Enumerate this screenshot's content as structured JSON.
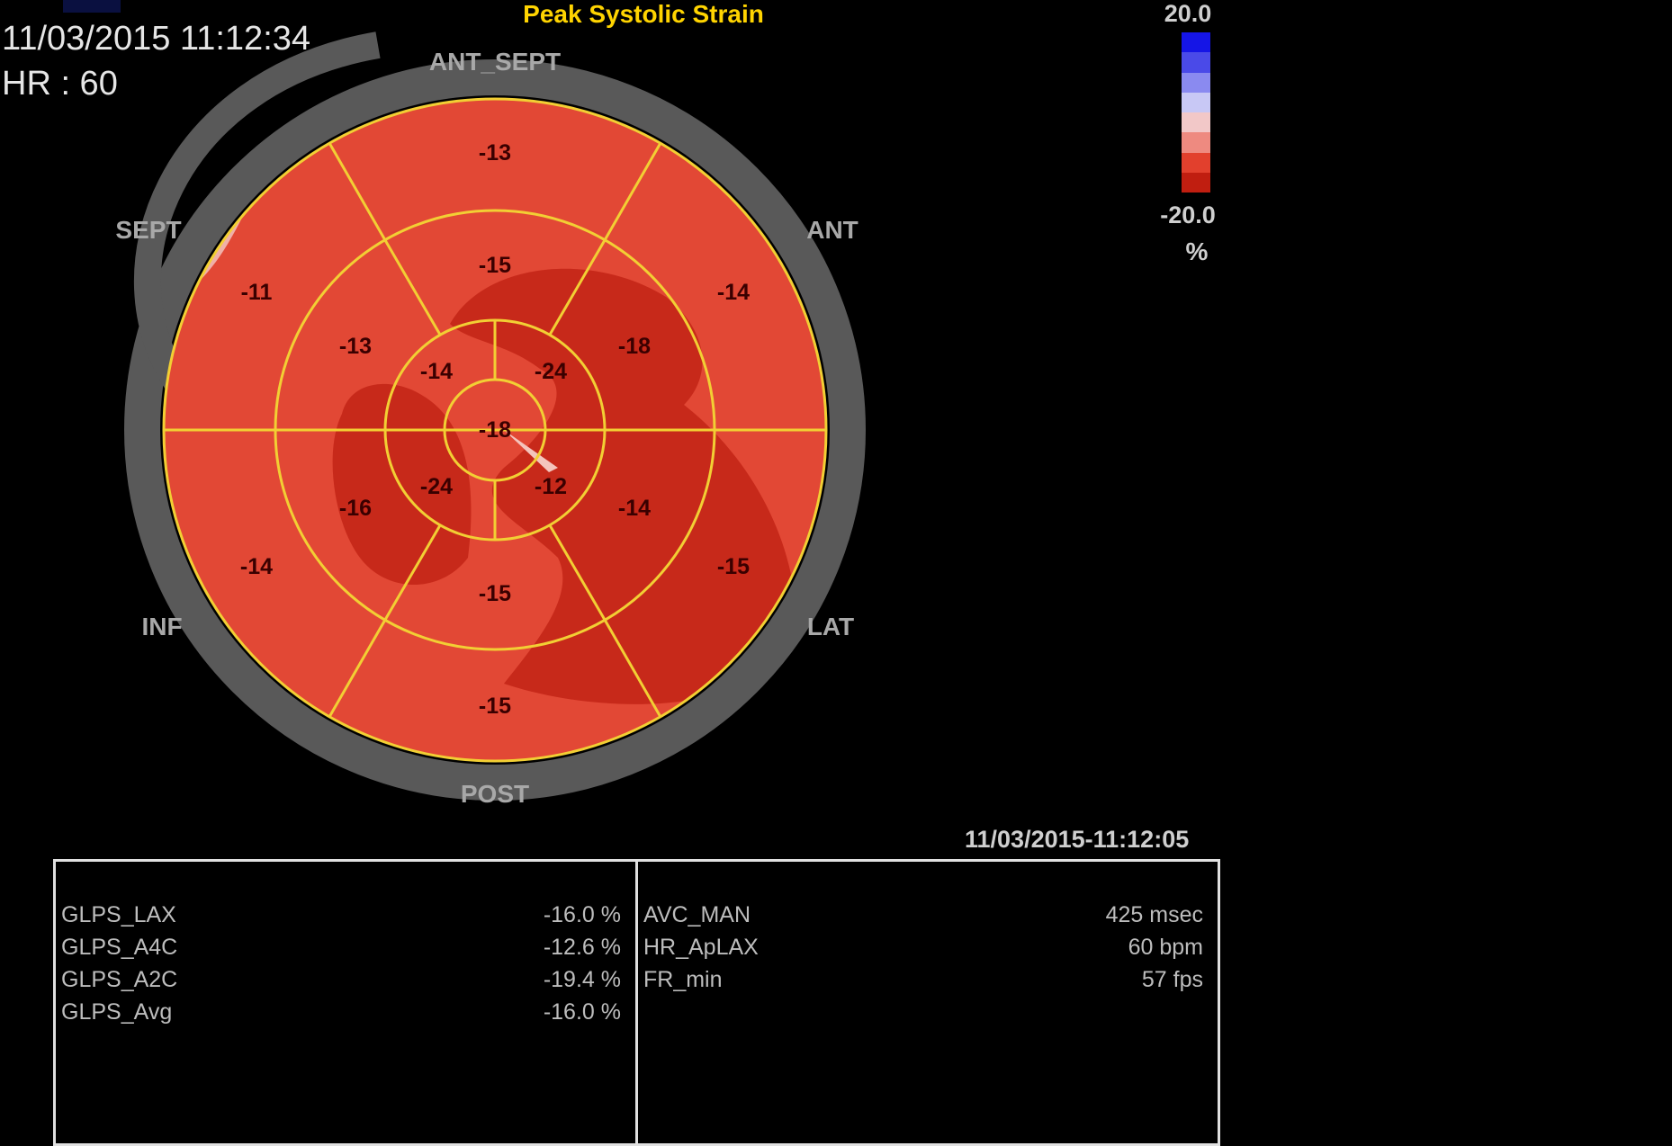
{
  "header": {
    "timestamp": "11/03/2015 11:12:34",
    "hr": "HR : 60",
    "title": "Peak Systolic Strain"
  },
  "scale": {
    "max_label": "20.0",
    "min_label": "-20.0",
    "unit": "%",
    "colors": [
      "#1515e6",
      "#4a4ae8",
      "#8a8af0",
      "#c8c8f5",
      "#f2c8c8",
      "#ee8a80",
      "#e2402d",
      "#c01e10"
    ]
  },
  "bullseye": {
    "wall_labels": {
      "ant_sept": "ANT_SEPT",
      "sept": "SEPT",
      "ant": "ANT",
      "inf": "INF",
      "lat": "LAT",
      "post": "POST"
    },
    "segments": {
      "basal": {
        "ant_sept": "-13",
        "ant": "-14",
        "lat": "-15",
        "post": "-15",
        "inf": "-14",
        "sept": "-11"
      },
      "mid": {
        "ant_sept": "-15",
        "ant": "-18",
        "lat": "-14",
        "post": "-15",
        "inf": "-16",
        "sept": "-13"
      },
      "apical": {
        "top_left": "-14",
        "top_right": "-24",
        "bottom_right": "-12",
        "bottom_left": "-24"
      },
      "apex": "-18"
    },
    "colors": {
      "base": "#e24835",
      "dark": "#c7291a",
      "light": "#f0b0a8",
      "border": "#f2cf34",
      "ring": "#595959"
    }
  },
  "footer": {
    "acquired_time": "11/03/2015-11:12:05",
    "left_panel": [
      {
        "key": "GLPS_LAX",
        "value": "-16.0 %"
      },
      {
        "key": "GLPS_A4C",
        "value": "-12.6 %"
      },
      {
        "key": "GLPS_A2C",
        "value": "-19.4 %"
      },
      {
        "key": "GLPS_Avg",
        "value": "-16.0 %"
      }
    ],
    "right_panel": [
      {
        "key": "AVC_MAN",
        "value": "425 msec"
      },
      {
        "key": "HR_ApLAX",
        "value": "60 bpm"
      },
      {
        "key": "FR_min",
        "value": "57 fps"
      }
    ]
  }
}
